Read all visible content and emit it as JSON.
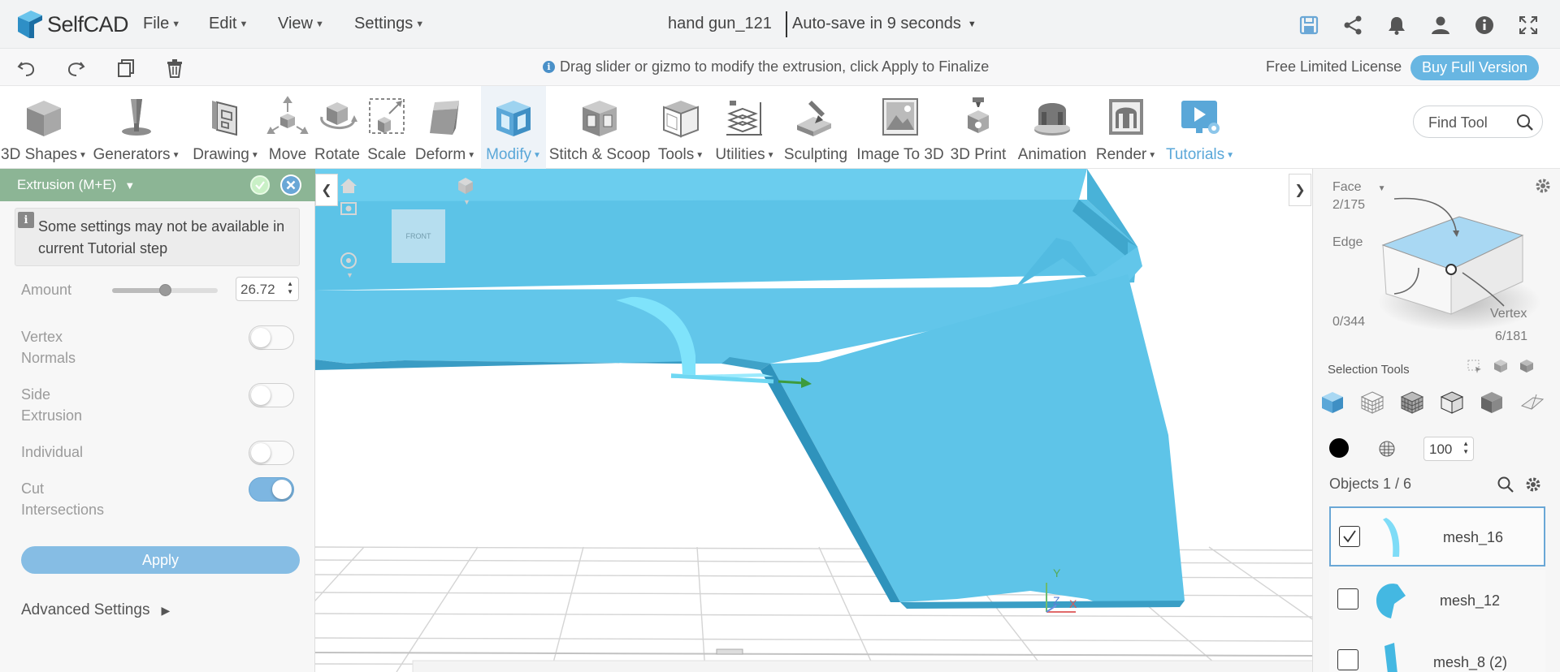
{
  "app": {
    "name": "SelfCAD",
    "document_title": "hand gun_121",
    "autosave": "Auto-save in 9 seconds"
  },
  "menu": {
    "file": "File",
    "edit": "Edit",
    "view": "View",
    "settings": "Settings"
  },
  "status": {
    "hint": "Drag slider or gizmo to modify the extrusion, click Apply to Finalize",
    "license": "Free Limited License",
    "buy_button": "Buy Full Version"
  },
  "toolbar": {
    "tools": [
      {
        "label": "3D Shapes",
        "dropdown": true
      },
      {
        "label": "Generators",
        "dropdown": true
      },
      {
        "label": "Drawing",
        "dropdown": true
      },
      {
        "label": "Move",
        "dropdown": false
      },
      {
        "label": "Rotate",
        "dropdown": false
      },
      {
        "label": "Scale",
        "dropdown": false
      },
      {
        "label": "Deform",
        "dropdown": true
      },
      {
        "label": "Modify",
        "dropdown": true,
        "active": true
      },
      {
        "label": "Stitch & Scoop",
        "dropdown": false
      },
      {
        "label": "Tools",
        "dropdown": true
      },
      {
        "label": "Utilities",
        "dropdown": true
      },
      {
        "label": "Sculpting",
        "dropdown": false
      },
      {
        "label": "Image To 3D",
        "dropdown": false
      },
      {
        "label": "3D Print",
        "dropdown": false
      },
      {
        "label": "Animation",
        "dropdown": false
      },
      {
        "label": "Render",
        "dropdown": true
      },
      {
        "label": "Tutorials",
        "dropdown": true
      }
    ],
    "find_tool_placeholder": "Find Tool"
  },
  "extrusion_panel": {
    "title": "Extrusion (M+E)",
    "notice": "Some settings may not be available in current Tutorial step",
    "amount_label": "Amount",
    "amount_value": "26.72",
    "amount_fraction": 0.5,
    "vertex_normals_label": "Vertex Normals",
    "vertex_normals_on": false,
    "side_extrusion_label": "Side Extrusion",
    "side_extrusion_on": false,
    "individual_label": "Individual",
    "individual_on": false,
    "cut_intersections_label": "Cut Intersections",
    "cut_intersections_on": true,
    "apply_button": "Apply",
    "advanced_settings": "Advanced Settings"
  },
  "viewport": {
    "view_cube_face": "FRONT",
    "axes": {
      "x": "X",
      "y": "Y",
      "z": "Z"
    }
  },
  "selection_panel": {
    "face_label": "Face",
    "face_count": "2/175",
    "edge_label": "Edge",
    "edge_count": "0/344",
    "vertex_label": "Vertex",
    "vertex_count": "6/181",
    "selection_tools_label": "Selection Tools",
    "opacity_value": "100",
    "objects_label": "Objects 1 / 6",
    "objects": [
      {
        "name": "mesh_16",
        "checked": true
      },
      {
        "name": "mesh_12",
        "checked": false
      },
      {
        "name": "mesh_8 (2)",
        "checked": false
      }
    ]
  },
  "colors": {
    "accent": "#5aa7d8",
    "model": "#5bc3e6",
    "panel_header": "#8cb595",
    "button": "#86bde4"
  }
}
